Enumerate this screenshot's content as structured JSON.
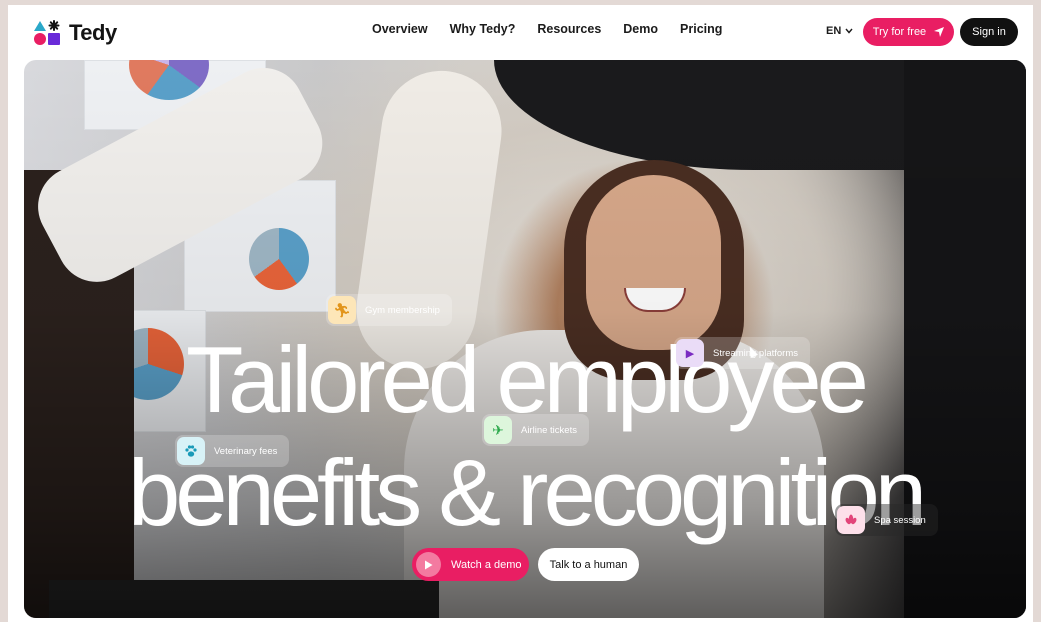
{
  "brand": {
    "name": "Tedy",
    "accent": "#e91e63"
  },
  "nav": {
    "items": [
      "Overview",
      "Why Tedy?",
      "Resources",
      "Demo",
      "Pricing"
    ]
  },
  "header": {
    "language": "EN",
    "try_label": "Try for free",
    "signin_label": "Sign in"
  },
  "hero": {
    "headline_line1": "Tailored employee",
    "headline_line2": "benefits & recognition",
    "chips": {
      "gym": {
        "label": "Gym membership",
        "icon": "running-icon"
      },
      "streaming": {
        "label": "Streaming platforms",
        "icon": "play-icon"
      },
      "vet": {
        "label": "Veterinary fees",
        "icon": "paw-icon"
      },
      "airline": {
        "label": "Airline tickets",
        "icon": "airplane-icon"
      },
      "spa": {
        "label": "Spa session",
        "icon": "lotus-icon"
      }
    },
    "demo_label": "Watch a demo",
    "human_label": "Talk to a human"
  }
}
